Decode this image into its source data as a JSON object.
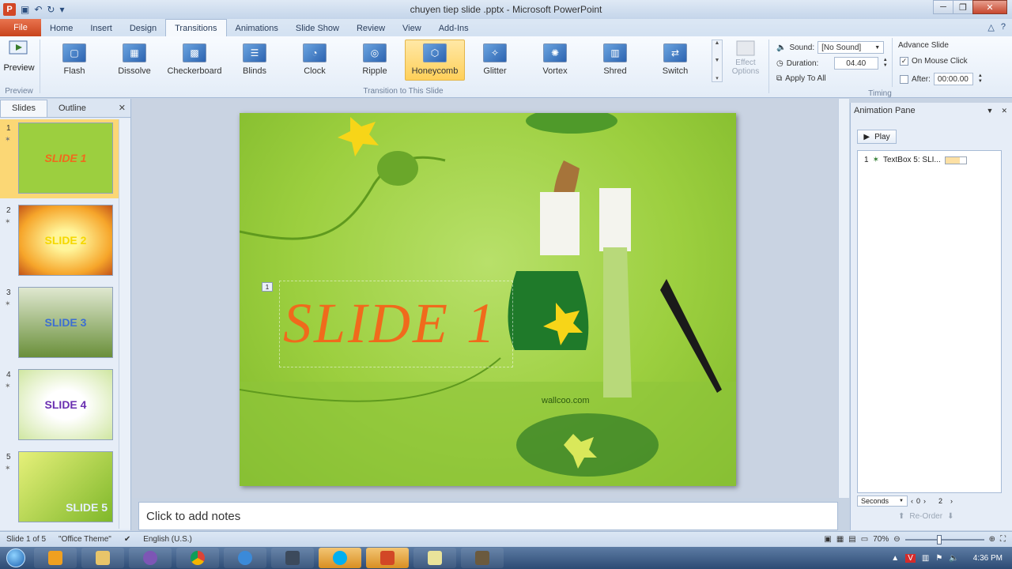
{
  "window": {
    "title": "chuyen tiep slide .pptx - Microsoft PowerPoint",
    "app_icon_letter": "P"
  },
  "tabs": {
    "file": "File",
    "items": [
      "Home",
      "Insert",
      "Design",
      "Transitions",
      "Animations",
      "Slide Show",
      "Review",
      "View",
      "Add-Ins"
    ],
    "active": "Transitions"
  },
  "ribbon": {
    "preview_label": "Preview",
    "preview_group": "Preview",
    "transitions": [
      {
        "label": "Flash",
        "selected": false
      },
      {
        "label": "Dissolve",
        "selected": false
      },
      {
        "label": "Checkerboard",
        "selected": false
      },
      {
        "label": "Blinds",
        "selected": false
      },
      {
        "label": "Clock",
        "selected": false
      },
      {
        "label": "Ripple",
        "selected": false
      },
      {
        "label": "Honeycomb",
        "selected": true
      },
      {
        "label": "Glitter",
        "selected": false
      },
      {
        "label": "Vortex",
        "selected": false
      },
      {
        "label": "Shred",
        "selected": false
      },
      {
        "label": "Switch",
        "selected": false
      }
    ],
    "transition_group": "Transition to This Slide",
    "effect_options": "Effect Options",
    "timing": {
      "sound_label": "Sound:",
      "sound_value": "[No Sound]",
      "duration_label": "Duration:",
      "duration_value": "04.40",
      "apply_all": "Apply To All",
      "advance_label": "Advance Slide",
      "on_mouse_click": "On Mouse Click",
      "on_mouse_click_checked": true,
      "after_label": "After:",
      "after_value": "00:00.00",
      "after_checked": false,
      "group": "Timing"
    }
  },
  "left_panel": {
    "tab_slides": "Slides",
    "tab_outline": "Outline",
    "slides": [
      {
        "num": "1",
        "text": "SLIDE 1",
        "active": true,
        "bg": "#9ccf3f",
        "fg": "#f06a1c"
      },
      {
        "num": "2",
        "text": "SLIDE 2",
        "active": false,
        "bg": "#f6a52a",
        "fg": "#f5d800"
      },
      {
        "num": "3",
        "text": "SLIDE 3",
        "active": false,
        "bg": "#6a8f3a",
        "fg": "#3d6fd1"
      },
      {
        "num": "4",
        "text": "SLIDE 4",
        "active": false,
        "bg": "#eef7d6",
        "fg": "#6a2fb0"
      },
      {
        "num": "5",
        "text": "SLIDE 5",
        "active": false,
        "bg": "#c7d93d",
        "fg": "#e5f0ff"
      }
    ]
  },
  "slide": {
    "title": "SLIDE 1",
    "anim_tag": "1",
    "watermark": "wallcoo.com"
  },
  "notes": {
    "placeholder": "Click to add notes"
  },
  "anim_pane": {
    "title": "Animation Pane",
    "play": "Play",
    "item_num": "1",
    "item_label": "TextBox 5: SLI...",
    "seconds": "Seconds",
    "timeline_start": "0",
    "timeline_end": "2",
    "reorder": "Re-Order"
  },
  "statusbar": {
    "slide_info": "Slide 1 of 5",
    "theme": "\"Office Theme\"",
    "language": "English (U.S.)",
    "zoom": "70%"
  },
  "taskbar": {
    "time": "4:36 PM"
  }
}
